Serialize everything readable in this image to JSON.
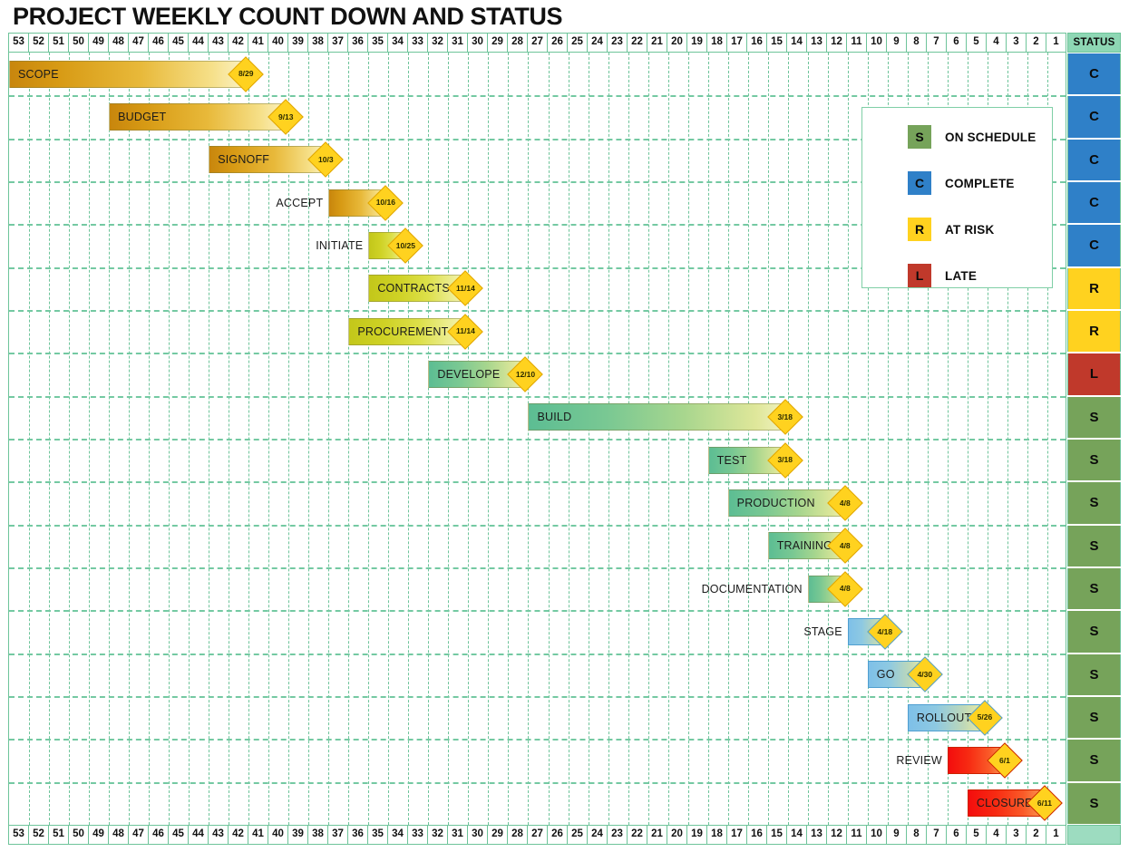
{
  "title": "PROJECT WEEKLY COUNT DOWN AND STATUS",
  "status_column": {
    "header": "STATUS"
  },
  "weeks": [
    53,
    52,
    51,
    50,
    49,
    48,
    47,
    46,
    45,
    44,
    43,
    42,
    41,
    40,
    39,
    38,
    37,
    36,
    35,
    34,
    33,
    32,
    31,
    30,
    29,
    28,
    27,
    26,
    25,
    24,
    23,
    22,
    21,
    20,
    19,
    18,
    17,
    16,
    15,
    14,
    13,
    12,
    11,
    10,
    9,
    8,
    7,
    6,
    5,
    4,
    3,
    2,
    1
  ],
  "legend": {
    "items": [
      {
        "code": "S",
        "label": "ON SCHEDULE",
        "color": "#76a35a"
      },
      {
        "code": "C",
        "label": "COMPLETE",
        "color": "#2f80c8"
      },
      {
        "code": "R",
        "label": "AT RISK",
        "color": "#ffd21f"
      },
      {
        "code": "L",
        "label": "LATE",
        "color": "#c0392b"
      }
    ]
  },
  "status_colors": {
    "S": "#76a35a",
    "C": "#2f80c8",
    "R": "#ffd21f",
    "L": "#c0392b"
  },
  "chart_data": {
    "type": "bar",
    "title": "PROJECT WEEKLY COUNT DOWN AND STATUS",
    "xlabel": "",
    "ylabel": "",
    "grid": true,
    "axis_direction": "descending",
    "x_ticks": [
      53,
      52,
      51,
      50,
      49,
      48,
      47,
      46,
      45,
      44,
      43,
      42,
      41,
      40,
      39,
      38,
      37,
      36,
      35,
      34,
      33,
      32,
      31,
      30,
      29,
      28,
      27,
      26,
      25,
      24,
      23,
      22,
      21,
      20,
      19,
      18,
      17,
      16,
      15,
      14,
      13,
      12,
      11,
      10,
      9,
      8,
      7,
      6,
      5,
      4,
      3,
      2,
      1
    ],
    "legend_position": "top-right-inset",
    "tasks": [
      {
        "name": "SCOPE",
        "start_week": 53,
        "end_week": 42,
        "milestone": "8/29",
        "status": "C",
        "label_inside": true,
        "bar_style": "orange"
      },
      {
        "name": "BUDGET",
        "start_week": 48,
        "end_week": 40,
        "milestone": "9/13",
        "status": "C",
        "label_inside": true,
        "bar_style": "orange"
      },
      {
        "name": "SIGNOFF",
        "start_week": 43,
        "end_week": 38,
        "milestone": "10/3",
        "status": "C",
        "label_inside": true,
        "bar_style": "orange"
      },
      {
        "name": "ACCEPT",
        "start_week": 37,
        "end_week": 35,
        "milestone": "10/16",
        "status": "C",
        "label_inside": false,
        "bar_style": "orange"
      },
      {
        "name": "INITIATE",
        "start_week": 35,
        "end_week": 34,
        "milestone": "10/25",
        "status": "C",
        "label_inside": false,
        "bar_style": "yellow"
      },
      {
        "name": "CONTRACTS",
        "start_week": 35,
        "end_week": 31,
        "milestone": "11/14",
        "status": "R",
        "label_inside": true,
        "bar_style": "yellow"
      },
      {
        "name": "PROCUREMENT",
        "start_week": 36,
        "end_week": 31,
        "milestone": "11/14",
        "status": "R",
        "label_inside": true,
        "bar_style": "yellow"
      },
      {
        "name": "DEVELOPE",
        "start_week": 32,
        "end_week": 28,
        "milestone": "12/10",
        "status": "L",
        "label_inside": true,
        "bar_style": "green"
      },
      {
        "name": "BUILD",
        "start_week": 27,
        "end_week": 15,
        "milestone": "3/18",
        "status": "S",
        "label_inside": true,
        "bar_style": "green"
      },
      {
        "name": "TEST",
        "start_week": 18,
        "end_week": 15,
        "milestone": "3/18",
        "status": "S",
        "label_inside": true,
        "bar_style": "green"
      },
      {
        "name": "PRODUCTION",
        "start_week": 17,
        "end_week": 12,
        "milestone": "4/8",
        "status": "S",
        "label_inside": true,
        "bar_style": "green"
      },
      {
        "name": "TRAINING",
        "start_week": 15,
        "end_week": 12,
        "milestone": "4/8",
        "status": "S",
        "label_inside": true,
        "bar_style": "green"
      },
      {
        "name": "DOCUMENTATION",
        "start_week": 13,
        "end_week": 12,
        "milestone": "4/8",
        "status": "S",
        "label_inside": false,
        "bar_style": "green"
      },
      {
        "name": "STAGE",
        "start_week": 11,
        "end_week": 10,
        "milestone": "4/18",
        "status": "S",
        "label_inside": false,
        "bar_style": "blue"
      },
      {
        "name": "GO",
        "start_week": 10,
        "end_week": 8,
        "milestone": "4/30",
        "status": "S",
        "label_inside": true,
        "bar_style": "blue"
      },
      {
        "name": "ROLLOUT",
        "start_week": 8,
        "end_week": 5,
        "milestone": "5/26",
        "status": "S",
        "label_inside": true,
        "bar_style": "blue"
      },
      {
        "name": "REVIEW",
        "start_week": 6,
        "end_week": 4,
        "milestone": "6/1",
        "status": "S",
        "label_inside": false,
        "bar_style": "red"
      },
      {
        "name": "CLOSURE",
        "start_week": 5,
        "end_week": 2,
        "milestone": "6/11",
        "status": "S",
        "label_inside": true,
        "bar_style": "red"
      }
    ]
  }
}
